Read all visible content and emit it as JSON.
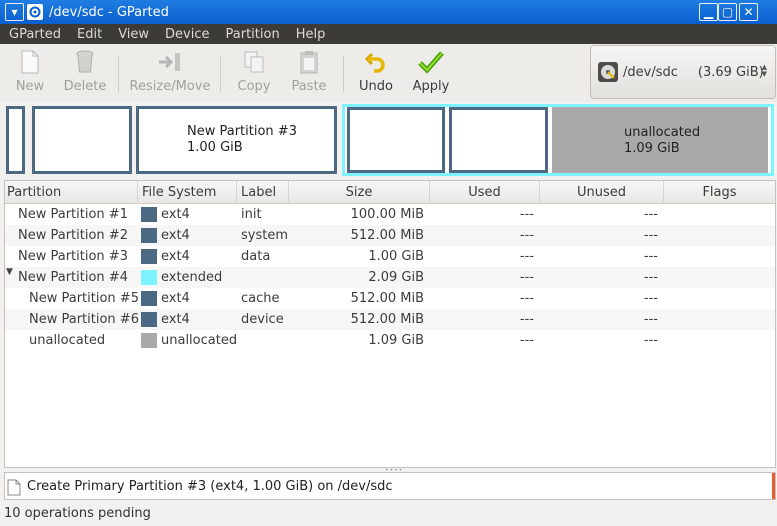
{
  "window": {
    "title": "/dev/sdc - GParted"
  },
  "menu": [
    "GParted",
    "Edit",
    "View",
    "Device",
    "Partition",
    "Help"
  ],
  "toolbar": {
    "new": "New",
    "delete": "Delete",
    "resize": "Resize/Move",
    "copy": "Copy",
    "paste": "Paste",
    "undo": "Undo",
    "apply": "Apply"
  },
  "device": {
    "name": "/dev/sdc",
    "size": "(3.69 GiB)"
  },
  "map": {
    "p3_name": "New Partition #3",
    "p3_size": "1.00 GiB",
    "unalloc_name": "unallocated",
    "unalloc_size": "1.09 GiB"
  },
  "columns": [
    "Partition",
    "File System",
    "Label",
    "Size",
    "Used",
    "Unused",
    "Flags"
  ],
  "rows": [
    {
      "partition": "New Partition #1",
      "fs": "ext4",
      "label": "init",
      "size": "100.00 MiB",
      "used": "---",
      "unused": "---",
      "flags": ""
    },
    {
      "partition": "New Partition #2",
      "fs": "ext4",
      "label": "system",
      "size": "512.00 MiB",
      "used": "---",
      "unused": "---",
      "flags": ""
    },
    {
      "partition": "New Partition #3",
      "fs": "ext4",
      "label": "data",
      "size": "1.00 GiB",
      "used": "---",
      "unused": "---",
      "flags": ""
    },
    {
      "partition": "New Partition #4",
      "fs": "extended",
      "label": "",
      "size": "2.09 GiB",
      "used": "---",
      "unused": "---",
      "flags": ""
    },
    {
      "partition": "New Partition #5",
      "fs": "ext4",
      "label": "cache",
      "size": "512.00 MiB",
      "used": "---",
      "unused": "---",
      "flags": ""
    },
    {
      "partition": "New Partition #6",
      "fs": "ext4",
      "label": "device",
      "size": "512.00 MiB",
      "used": "---",
      "unused": "---",
      "flags": ""
    },
    {
      "partition": "unallocated",
      "fs": "unallocated",
      "label": "",
      "size": "1.09 GiB",
      "used": "---",
      "unused": "---",
      "flags": ""
    }
  ],
  "colors": {
    "ext4": "#4b6983",
    "extended": "#7df3ff",
    "unallocated": "#a9a9a9"
  },
  "operations": {
    "current": "Create Primary Partition #3 (ext4, 1.00 GiB) on /dev/sdc"
  },
  "status": "10 operations pending"
}
